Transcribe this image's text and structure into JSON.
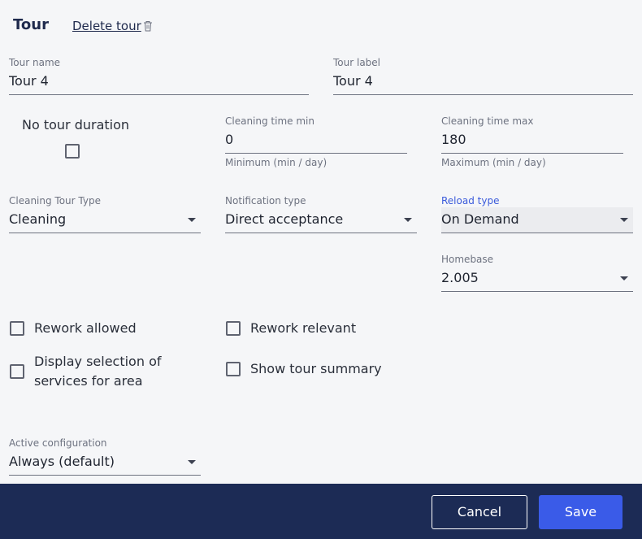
{
  "header": {
    "title": "Tour",
    "delete_label": "Delete tour",
    "delete_icon": "trash-icon"
  },
  "tour_name": {
    "label": "Tour name",
    "value": "Tour 4"
  },
  "tour_label": {
    "label": "Tour label",
    "value": "Tour 4"
  },
  "no_tour_duration": {
    "label": "No tour duration",
    "checked": false
  },
  "cleaning_time_min": {
    "label": "Cleaning time min",
    "value": "0",
    "helper": "Minimum (min / day)"
  },
  "cleaning_time_max": {
    "label": "Cleaning time max",
    "value": "180",
    "helper": "Maximum (min / day)"
  },
  "cleaning_tour_type": {
    "label": "Cleaning Tour Type",
    "value": "Cleaning"
  },
  "notification_type": {
    "label": "Notification type",
    "value": "Direct acceptance"
  },
  "reload_type": {
    "label": "Reload type",
    "value": "On Demand"
  },
  "homebase": {
    "label": "Homebase",
    "value": "2.005"
  },
  "options": {
    "rework_allowed": {
      "label": "Rework allowed",
      "checked": false
    },
    "rework_relevant": {
      "label": "Rework relevant",
      "checked": false
    },
    "display_selection_line1": "Display selection of",
    "display_selection_line2": "services for area",
    "show_tour_summary": {
      "label": "Show tour summary",
      "checked": false
    }
  },
  "active_configuration": {
    "label": "Active configuration",
    "value": "Always (default)"
  },
  "footer": {
    "cancel_label": "Cancel",
    "save_label": "Save"
  },
  "colors": {
    "accent": "#3a5be8",
    "footer_bg": "#1c2b55",
    "active_label": "#3b5bdb"
  }
}
